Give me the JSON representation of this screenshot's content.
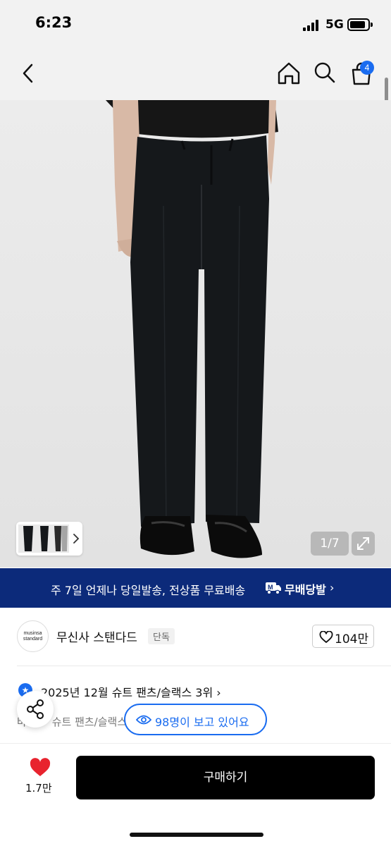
{
  "status_bar": {
    "time": "6:23",
    "network": "5G"
  },
  "nav": {
    "cart_count": "4"
  },
  "product_image": {
    "counter": "1/7"
  },
  "shipping_banner": {
    "text": "주 7일 언제나 당일발송, 전상품 무료배송",
    "brand": "무배당발"
  },
  "brand": {
    "logo_text": "musinsa standard",
    "name": "무신사 스탠다드",
    "badge": "단독",
    "likes": "104만"
  },
  "ranking": {
    "text": "2025년 12월 슈트 팬츠/슬랙스 3위"
  },
  "category": {
    "text": "바지 > 슈트 팬츠/슬랙스"
  },
  "viewers": {
    "text": "98명이 보고 있어요"
  },
  "bottom_bar": {
    "favorite_count": "1.7만",
    "buy_label": "구매하기"
  },
  "colors": {
    "accent": "#1a6cf0",
    "banner": "#0c2a7a",
    "heart": "#e8232e",
    "buy_button": "#000000"
  }
}
